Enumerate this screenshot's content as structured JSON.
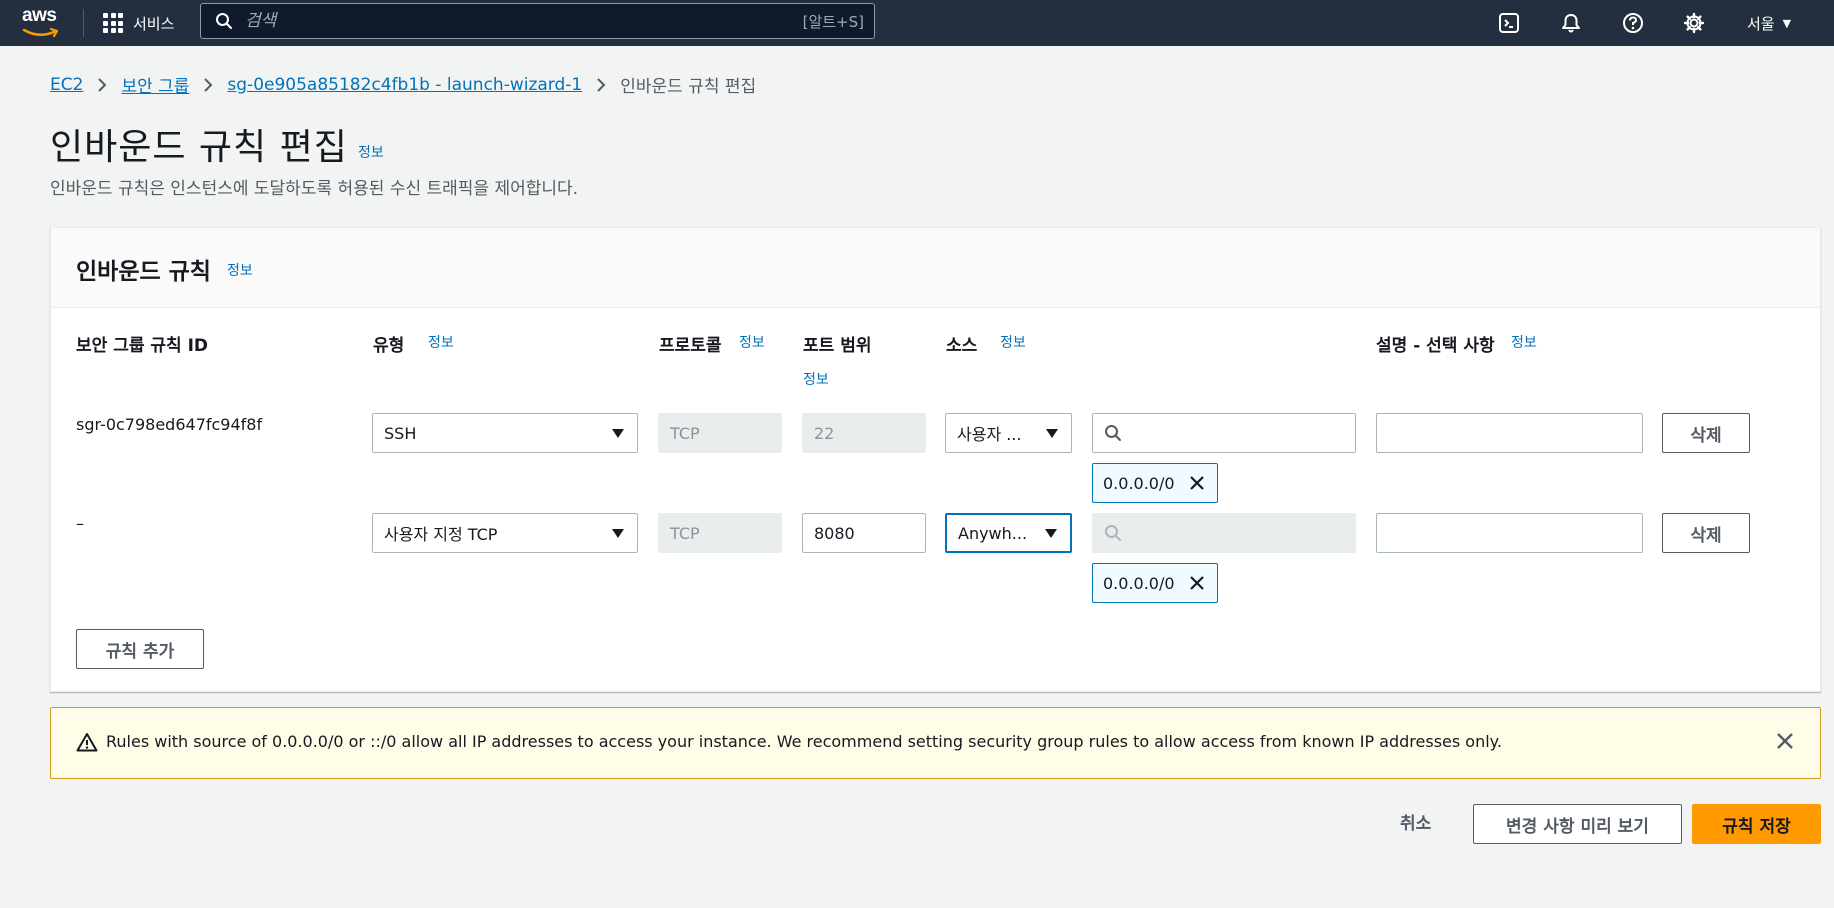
{
  "topbar": {
    "logo_text": "aws",
    "services_label": "서비스",
    "search_placeholder": "검색",
    "search_shortcut": "[알트+S]",
    "region": "서울"
  },
  "breadcrumb": {
    "items": [
      "EC2",
      "보안 그룹",
      "sg-0e905a85182c4fb1b - launch-wizard-1"
    ],
    "current": "인바운드 규칙 편집"
  },
  "header": {
    "title": "인바운드 규칙 편집",
    "info": "정보",
    "description": "인바운드 규칙은 인스턴스에 도달하도록 허용된 수신 트래픽을 제어합니다."
  },
  "panel": {
    "title": "인바운드 규칙",
    "info": "정보",
    "columns": {
      "rule_id": "보안 그룹 규칙 ID",
      "type": "유형",
      "protocol": "프로토콜",
      "port_range": "포트 범위",
      "source": "소스",
      "description": "설명 - 선택 사항"
    },
    "info_label": "정보",
    "rows": [
      {
        "rule_id": "sgr-0c798ed647fc94f8f",
        "type": "SSH",
        "protocol": "TCP",
        "port": "22",
        "source_type": "사용자 ...",
        "source_token": "0.0.0.0/0",
        "description": "",
        "delete_label": "삭제"
      },
      {
        "rule_id": "–",
        "type": "사용자 지정 TCP",
        "protocol": "TCP",
        "port": "8080",
        "source_type": "Anywh...",
        "source_token": "0.0.0.0/0",
        "description": "",
        "delete_label": "삭제"
      }
    ],
    "add_rule_label": "규칙 추가"
  },
  "alert": {
    "text": "Rules with source of 0.0.0.0/0 or ::/0 allow all IP addresses to access your instance. We recommend setting security group rules to allow access from known IP addresses only."
  },
  "footer": {
    "cancel_label": "취소",
    "preview_label": "변경 사항 미리 보기",
    "save_label": "규칙 저장"
  },
  "colors": {
    "topbar": "#232f3e",
    "link": "#0073bb",
    "primary": "#ff9900",
    "warning_border": "#d09d1e"
  }
}
